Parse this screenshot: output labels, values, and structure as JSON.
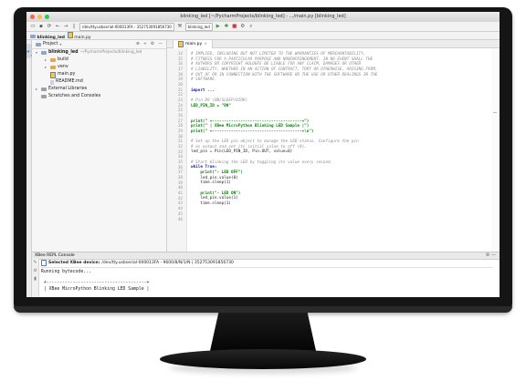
{
  "window": {
    "title": "blinking_led [~/PycharmProjects/blinking_led] - .../main.py [blinking_led]"
  },
  "toolbar": {
    "port_selector": "/dev/tty.usbserial-000013FA - 352753091856730",
    "run_config": "blinking_led"
  },
  "navbar": {
    "project": "blinking_led",
    "file": "main.py"
  },
  "left_stripe": {
    "tab_label": "1: Project"
  },
  "project_panel": {
    "header": "Project",
    "tree": [
      {
        "label": "blinking_led",
        "hint": "~/PycharmProjects/blinking_led",
        "kind": "folder-root"
      },
      {
        "label": "build",
        "hint": "",
        "kind": "folder-orange"
      },
      {
        "label": "venv",
        "hint": "",
        "kind": "folder-orange"
      },
      {
        "label": "main.py",
        "hint": "",
        "kind": "py"
      },
      {
        "label": "README.md",
        "hint": "",
        "kind": "md"
      },
      {
        "label": "External Libraries",
        "hint": "",
        "kind": "lib"
      },
      {
        "label": "Scratches and Consoles",
        "hint": "",
        "kind": "scratch"
      }
    ]
  },
  "editor": {
    "tab_label": "main.py",
    "line_numbers": [
      "14",
      "15",
      "16",
      "17",
      "18",
      "19",
      "20",
      "21",
      "22",
      "23",
      "24",
      "25",
      "26",
      "27",
      "28",
      "29",
      "30",
      "31",
      "32",
      "33",
      "34",
      "35",
      "36",
      "37",
      "38",
      "39",
      "40",
      "41",
      "42",
      "43",
      "44",
      "45",
      "46"
    ],
    "lines": [
      {
        "t": "# IMPLIED, INCLUDING BUT NOT LIMITED TO THE WARRANTIES OF MERCHANTABILITY,",
        "c": "com"
      },
      {
        "t": "# FITNESS FOR A PARTICULAR PURPOSE AND NONINFRINGEMENT. IN NO EVENT SHALL THE",
        "c": "com"
      },
      {
        "t": "# AUTHORS OR COPYRIGHT HOLDERS BE LIABLE FOR ANY CLAIM, DAMAGES OR OTHER",
        "c": "com"
      },
      {
        "t": "# LIABILITY, WHETHER IN AN ACTION OF CONTRACT, TORT OR OTHERWISE, ARISING FROM,",
        "c": "com"
      },
      {
        "t": "# OUT OF OR IN CONNECTION WITH THE SOFTWARE OR THE USE OR OTHER DEALINGS IN THE",
        "c": "com"
      },
      {
        "t": "# SOFTWARE.",
        "c": "com"
      },
      {
        "t": "",
        "c": ""
      },
      {
        "t": "import ...",
        "c": "kw"
      },
      {
        "t": "",
        "c": ""
      },
      {
        "t": "# Pin D9 (ON/SLEEP/DIO9)",
        "c": "com"
      },
      {
        "t": "LED_PIN_ID = \"D9\"",
        "c": "assign_str"
      },
      {
        "t": "",
        "c": ""
      },
      {
        "t": "",
        "c": ""
      },
      {
        "t": "print(\" +--------------------------------------+\")",
        "c": "print"
      },
      {
        "t": "print(\" | XBee MicroPython Blinking LED Sample |\")",
        "c": "print"
      },
      {
        "t": "print(\" +--------------------------------------+\\n\")",
        "c": "print"
      },
      {
        "t": "",
        "c": ""
      },
      {
        "t": "# Set up the LED pin object to manage the LED status. Configure the pin",
        "c": "com"
      },
      {
        "t": "# as output and set its initial value to off (0).",
        "c": "com"
      },
      {
        "t": "led_pin = Pin(LED_PIN_ID, Pin.OUT, value=0)",
        "c": "plain"
      },
      {
        "t": "",
        "c": ""
      },
      {
        "t": "# Start blinking the LED by toggling its value every second.",
        "c": "com"
      },
      {
        "t": "while True:",
        "c": "kw"
      },
      {
        "t": "    print(\"- LED OFF\")",
        "c": "print"
      },
      {
        "t": "    led_pin.value(0)",
        "c": "plain"
      },
      {
        "t": "    time.sleep(1)",
        "c": "plain"
      },
      {
        "t": "",
        "c": ""
      },
      {
        "t": "    print(\"- LED ON\")",
        "c": "print"
      },
      {
        "t": "    led_pin.value(1)",
        "c": "plain"
      },
      {
        "t": "    time.sleep(1)",
        "c": "plain"
      },
      {
        "t": "",
        "c": ""
      },
      {
        "t": "",
        "c": ""
      },
      {
        "t": "",
        "c": ""
      }
    ]
  },
  "repl": {
    "title": "XBee REPL Console",
    "selected_label": "Selected XBee device:",
    "selected_value": "/dev/tty.usbserial-000013FA - 9600/8/N/1/N  |  352753091856730",
    "output": [
      "Running bytecode...",
      "",
      " +--------------------------------------+",
      " | XBee MicroPython Blinking LED Sample |"
    ]
  }
}
